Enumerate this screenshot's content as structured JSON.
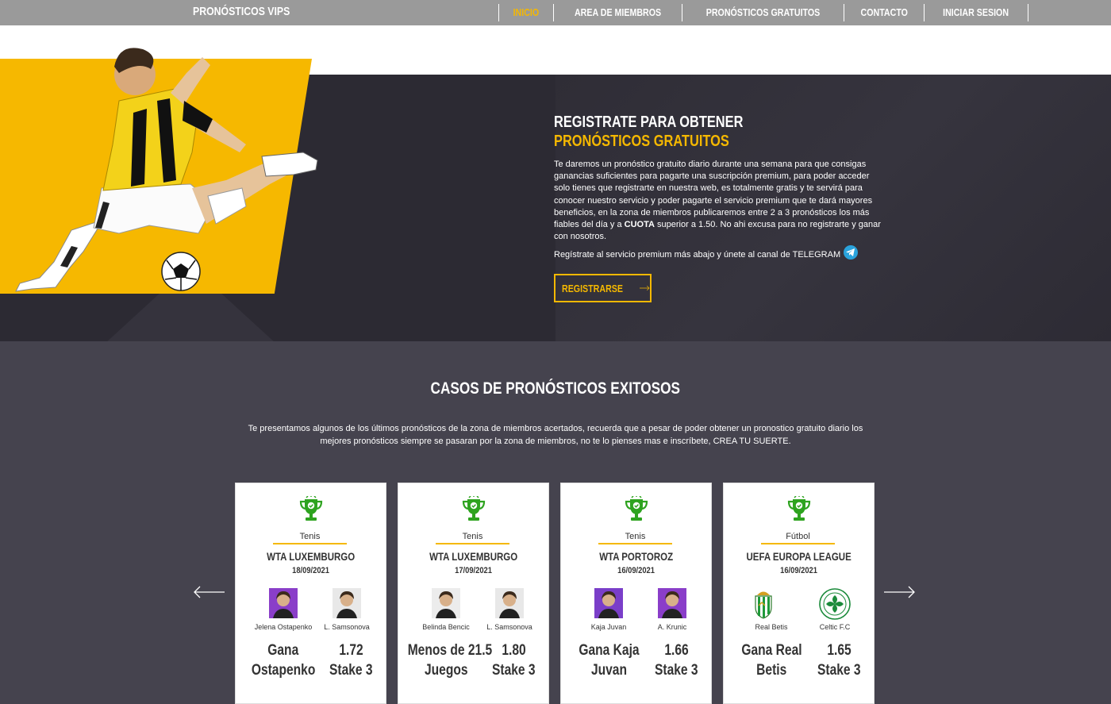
{
  "nav": {
    "brand": "PRONÓSTICOS VIPS",
    "items": [
      {
        "label": "INICIO",
        "active": true
      },
      {
        "label": "AREA DE MIEMBROS",
        "active": false
      },
      {
        "label": "PRONÓSTICOS GRATUITOS",
        "active": false
      },
      {
        "label": "CONTACTO",
        "active": false
      },
      {
        "label": "INICIAR SESION",
        "active": false
      }
    ]
  },
  "hero": {
    "title_line1": "REGISTRATE PARA OBTENER",
    "title_line2": "PRONÓSTICOS GRATUITOS",
    "paragraph_part1": "Te daremos un pronóstico gratuito diario durante una semana para que consigas ganancias suficientes para pagarte una suscripción premium, para poder acceder solo tienes que registrarte en nuestra web, es totalmente gratis y te servirá para conocer nuestro servicio y poder pagarte el servicio premium que te dará mayores beneficios, en la zona de miembros publicaremos entre 2 a 3 pronósticos los más fiables del día y a ",
    "paragraph_bold": "CUOTA",
    "paragraph_part2": " superior a 1.50. No ahi excusa para no registrarte y ganar con nosotros.",
    "telegram_line": "Regístrate al servicio premium más abajo y únete al canal de TELEGRAM",
    "register_button": "REGISTRARSE",
    "accent_color": "#f5b800"
  },
  "success": {
    "title": "CASOS DE PRONÓSTICOS EXITOSOS",
    "description": "Te presentamos algunos de los últimos pronósticos de la zona de miembros acertados, recuerda que a pesar de poder obtener un pronostico gratuito diario los mejores pronósticos siempre se pasaran por la zona de miembros, no te lo pienses mas e inscríbete, CREA TU SUERTE.",
    "prev_icon": "arrow-left-icon",
    "next_icon": "arrow-right-icon",
    "cards": [
      {
        "sport": "Tenis",
        "event": "WTA LUXEMBURGO",
        "date": "18/09/2021",
        "player1": "Jelena Ostapenko",
        "player2": "L. Samsonova",
        "pick_line1": "Gana",
        "pick_line2": "Ostapenko",
        "odds": "1.72",
        "stake": "Stake 3"
      },
      {
        "sport": "Tenis",
        "event": "WTA LUXEMBURGO",
        "date": "17/09/2021",
        "player1": "Belinda Bencic",
        "player2": "L. Samsonova",
        "pick_line1": "Menos de 21.5",
        "pick_line2": "Juegos",
        "odds": "1.80",
        "stake": "Stake 3"
      },
      {
        "sport": "Tenis",
        "event": "WTA PORTOROZ",
        "date": "16/09/2021",
        "player1": "Kaja Juvan",
        "player2": "A. Krunic",
        "pick_line1": "Gana Kaja",
        "pick_line2": "Juvan",
        "odds": "1.66",
        "stake": "Stake 3"
      },
      {
        "sport": "Fútbol",
        "event": "UEFA EUROPA LEAGUE",
        "date": "16/09/2021",
        "player1": "Real Betis",
        "player2": "Celtic F.C",
        "pick_line1": "Gana Real",
        "pick_line2": "Betis",
        "odds": "1.65",
        "stake": "Stake 3"
      }
    ]
  }
}
